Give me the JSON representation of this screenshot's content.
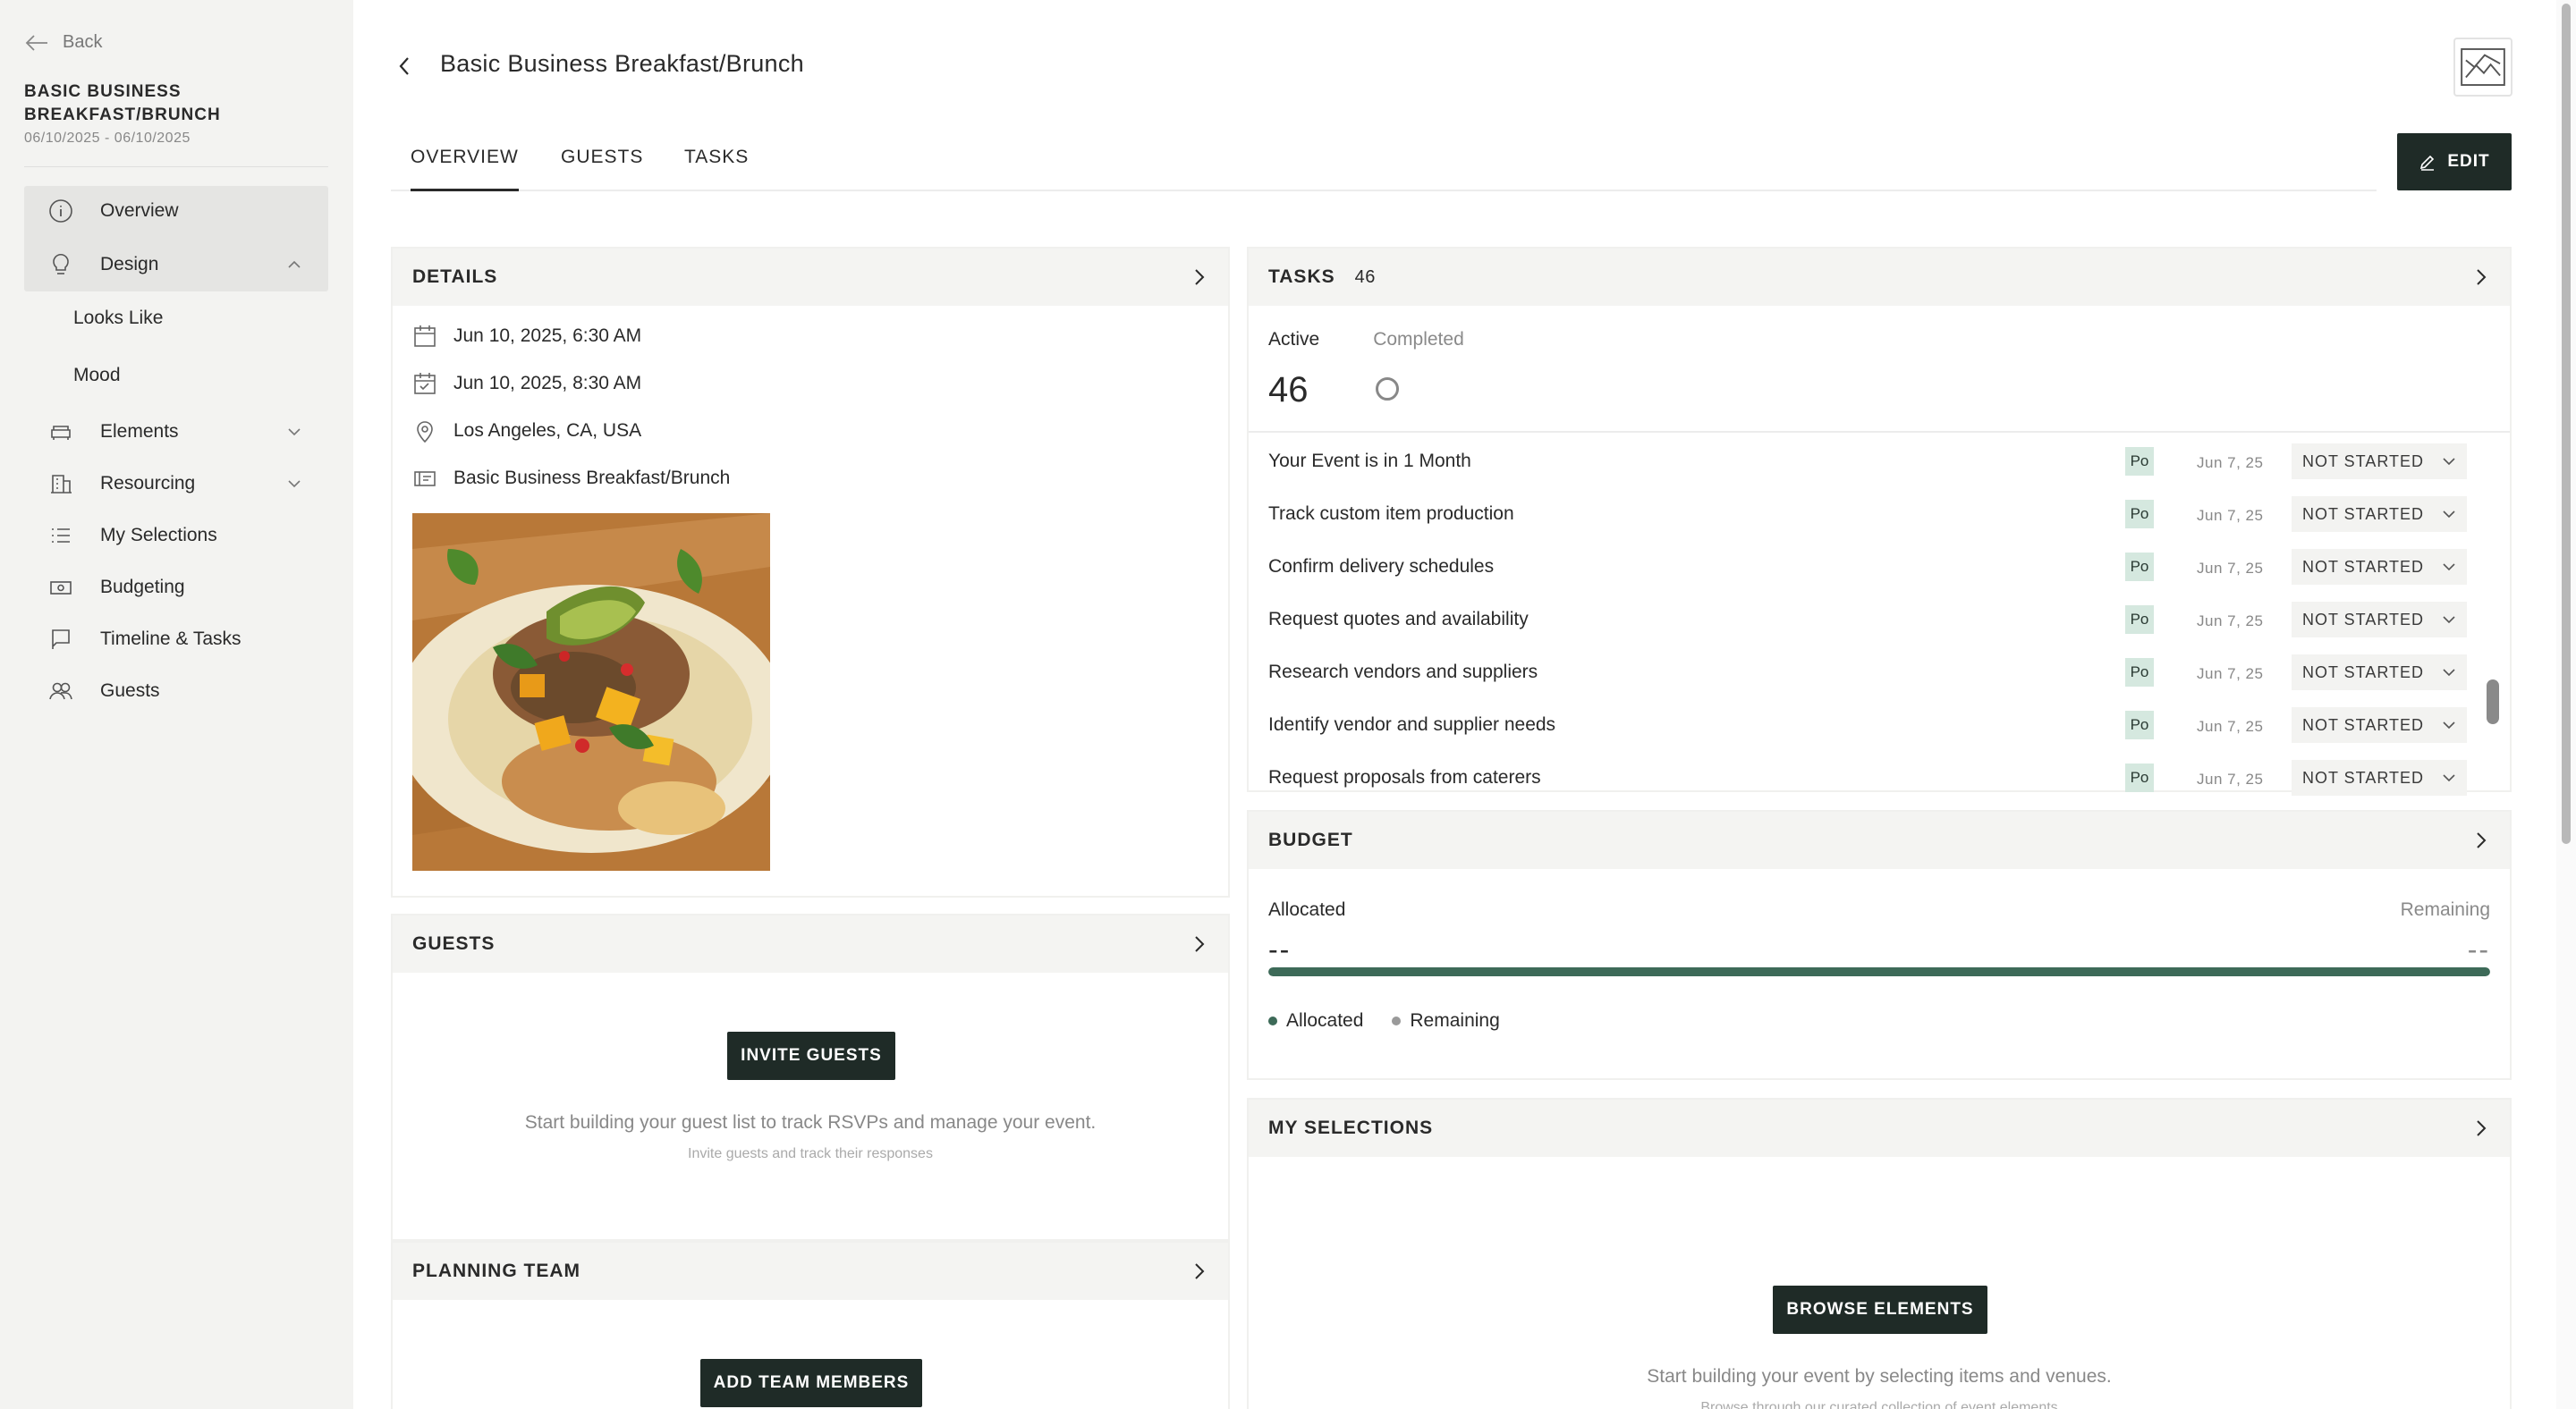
{
  "sidebar": {
    "back_label": "Back",
    "event_title": "BASIC BUSINESS BREAKFAST/BRUNCH",
    "event_dates": "06/10/2025 - 06/10/2025",
    "nav": {
      "overview": "Overview",
      "design": "Design",
      "looks_like": "Looks Like",
      "mood": "Mood",
      "elements": "Elements",
      "resourcing": "Resourcing",
      "my_selections": "My Selections",
      "budgeting": "Budgeting",
      "timeline_tasks": "Timeline & Tasks",
      "guests": "Guests"
    }
  },
  "header": {
    "title": "Basic Business Breakfast/Brunch",
    "edit_label": "EDIT"
  },
  "tabs": [
    {
      "label": "OVERVIEW",
      "active": true
    },
    {
      "label": "GUESTS",
      "active": false
    },
    {
      "label": "TASKS",
      "active": false
    }
  ],
  "details": {
    "title": "DETAILS",
    "start": "Jun 10, 2025, 6:30 AM",
    "end": "Jun 10, 2025, 8:30 AM",
    "location": "Los Angeles, CA, USA",
    "name": "Basic Business Breakfast/Brunch"
  },
  "guests": {
    "title": "GUESTS",
    "button": "INVITE GUESTS",
    "message": "Start building your guest list to track RSVPs and manage your event.",
    "sub_message": "Invite guests and track their responses"
  },
  "planning_team": {
    "title": "PLANNING TEAM",
    "button": "ADD TEAM MEMBERS"
  },
  "tasks": {
    "title": "TASKS",
    "count": "46",
    "active_label": "Active",
    "completed_label": "Completed",
    "active_count": "46",
    "rows": [
      {
        "name": "Your Event is in 1 Month",
        "badge": "Po",
        "date": "Jun 7, 25",
        "status": "NOT STARTED"
      },
      {
        "name": "Track custom item production",
        "badge": "Po",
        "date": "Jun 7, 25",
        "status": "NOT STARTED"
      },
      {
        "name": "Confirm delivery schedules",
        "badge": "Po",
        "date": "Jun 7, 25",
        "status": "NOT STARTED"
      },
      {
        "name": "Request quotes and availability",
        "badge": "Po",
        "date": "Jun 7, 25",
        "status": "NOT STARTED"
      },
      {
        "name": "Research vendors and suppliers",
        "badge": "Po",
        "date": "Jun 7, 25",
        "status": "NOT STARTED"
      },
      {
        "name": "Identify vendor and supplier needs",
        "badge": "Po",
        "date": "Jun 7, 25",
        "status": "NOT STARTED"
      },
      {
        "name": "Request proposals from caterers",
        "badge": "Po",
        "date": "Jun 7, 25",
        "status": "NOT STARTED"
      }
    ]
  },
  "budget": {
    "title": "BUDGET",
    "allocated_label": "Allocated",
    "remaining_label": "Remaining",
    "allocated_value": "--",
    "remaining_value": "--",
    "allocated_fraction": 1.0,
    "legend_allocated": "Allocated",
    "legend_remaining": "Remaining",
    "colors": {
      "allocated": "#3d6a58",
      "remaining": "#9a9a9a"
    }
  },
  "my_selections": {
    "title": "MY SELECTIONS",
    "button": "BROWSE ELEMENTS",
    "message": "Start building your event by selecting items and venues.",
    "sub_message": "Browse through our curated collection of event elements"
  },
  "colors": {
    "accent_dark": "#1f2b27",
    "sidebar_bg": "#f3f3f1",
    "badge_bg": "#d5e8df"
  }
}
